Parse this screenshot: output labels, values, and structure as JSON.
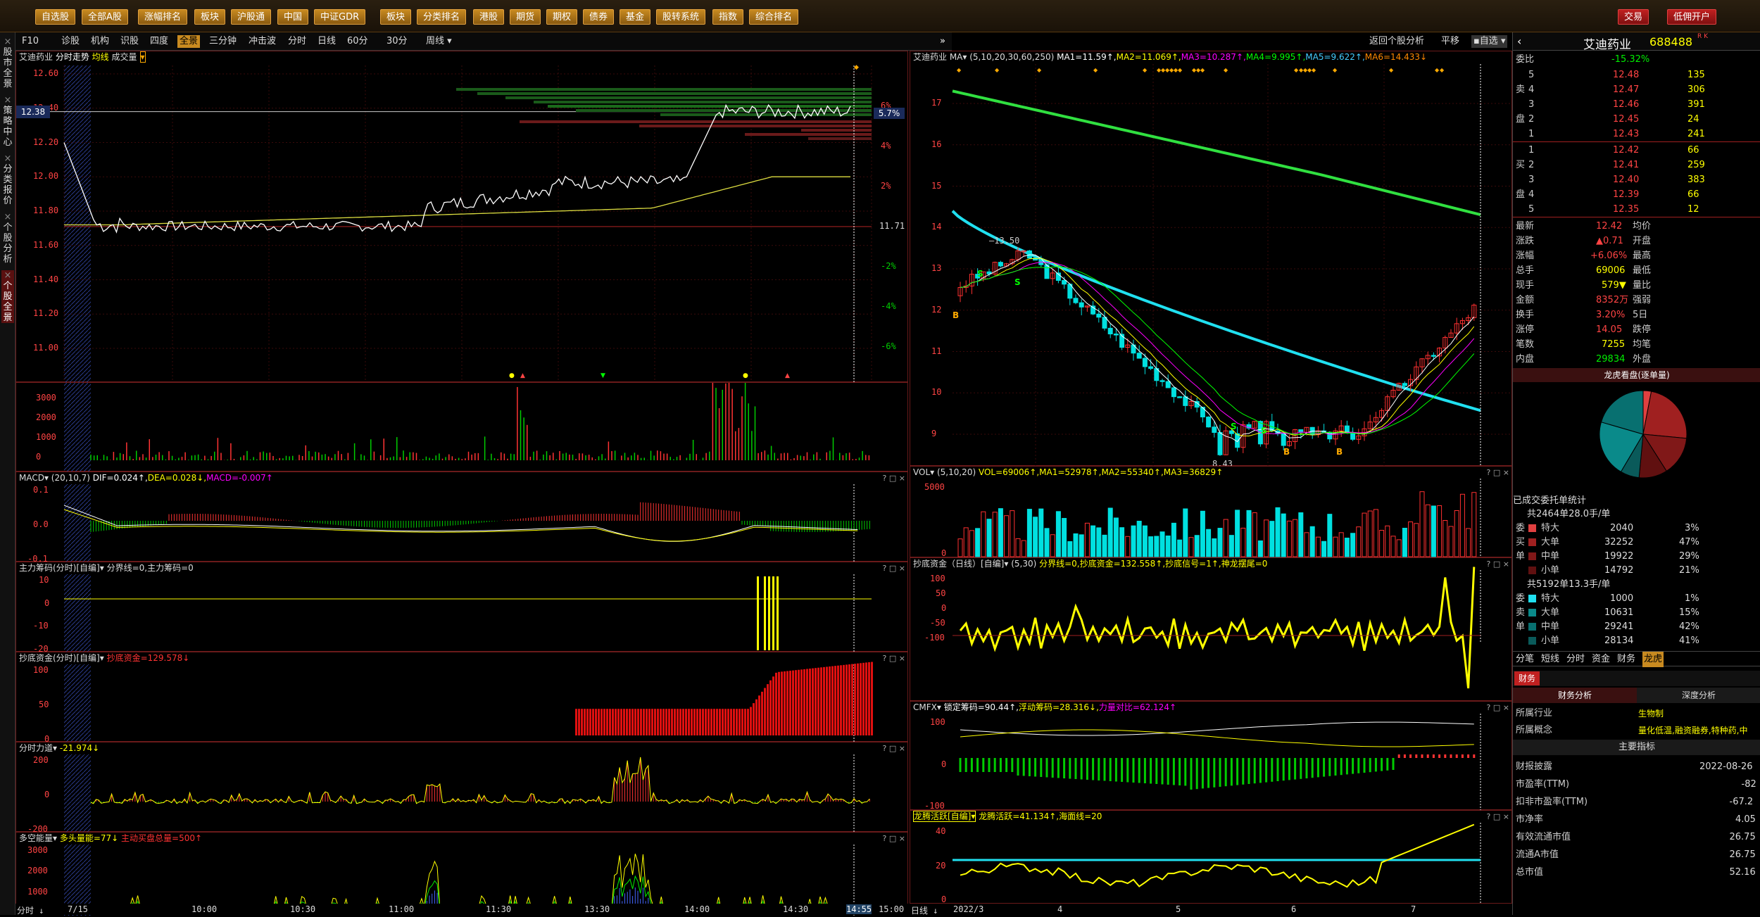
{
  "topbar": {
    "buttons": [
      "自选股",
      "全部A股",
      "涨幅排名",
      "板块",
      "沪股通",
      "中国",
      "中证GDR",
      "板块",
      "分类排名",
      "港股",
      "期货",
      "期权",
      "债券",
      "基金",
      "股转系统",
      "指数",
      "综合排名"
    ],
    "trade": "交易",
    "margin": "低佣开户"
  },
  "lefttabs": [
    "股市全景",
    "策略中心",
    "分类报价",
    "个股分析",
    "个股全景"
  ],
  "toolbar2": {
    "items": [
      "F10",
      "诊股",
      "机构",
      "识股",
      "四度",
      "全景",
      "三分钟",
      "冲击波",
      "分时",
      "日线",
      "60分",
      "30分",
      "周线"
    ],
    "right_items": [
      "返回个股分析",
      "平移",
      "自选"
    ]
  },
  "left": {
    "stock_name": "艾迪药业",
    "title": "分时走势",
    "avg_label": "均线",
    "vol_label": "成交量",
    "price_axis": [
      "12.60",
      "12.40",
      "12.20",
      "12.00",
      "11.80",
      "11.60",
      "11.40",
      "11.20",
      "11.00"
    ],
    "pct_axis": [
      "6%",
      "4%",
      "2%",
      "",
      "-2%",
      "-4%",
      "-6%"
    ],
    "cur_price": "12.38",
    "cur_pct": "5.7%",
    "prev_close": "11.71",
    "vol_axis": [
      "3000",
      "2000",
      "1000",
      "0"
    ],
    "time_axis": [
      "7/15",
      "10:00",
      "10:30",
      "11:00",
      "11:30",
      "13:30",
      "14:00",
      "14:30",
      "14:55",
      "15:00"
    ],
    "footer": "分时",
    "macd": {
      "head": "MACD",
      "params": "(20,10,7)",
      "dif": "DIF=0.024↑",
      "dea": "DEA=0.028↓",
      "macd": "MACD=-0.007↑",
      "axis": [
        "0.1",
        "0.0",
        "-0.1"
      ]
    },
    "zl": {
      "head": "主力筹码(分时)[自编]",
      "text": "分界线=0,主力筹码=0",
      "axis": [
        "10",
        "0",
        "-10",
        "-20"
      ]
    },
    "cd": {
      "head": "抄底资金(分时)[自编]",
      "text": "抄底资金=129.578↓",
      "axis": [
        "100",
        "50",
        "0"
      ]
    },
    "fs": {
      "head": "分时力道",
      "text": "-21.974↓",
      "axis": [
        "200",
        "0",
        "-200"
      ]
    },
    "dk": {
      "head": "多空能量",
      "text1": "多头量能=77↓",
      "text2": "主动买盘总量=500↑",
      "axis": [
        "3000",
        "2000",
        "1000",
        "0"
      ]
    }
  },
  "kline": {
    "head": "艾迪药业",
    "ma_label": "MA",
    "params": "(5,10,20,30,60,250)",
    "ma_values": [
      "MA1=11.59↑",
      "MA2=11.069↑",
      "MA3=10.287↑",
      "MA4=9.995↑",
      "MA5=9.622↑",
      "MA6=14.433↓"
    ],
    "price_axis": [
      "17",
      "16",
      "15",
      "14",
      "13",
      "12",
      "11",
      "10",
      "9"
    ],
    "high_label": "13.50",
    "low_label": "8.43",
    "vol": {
      "head": "VOL",
      "params": "(5,10,20)",
      "text": "VOL=69006↑,MA1=52978↑,MA2=55340↑,MA3=36829↑",
      "axis": [
        "5000",
        "0"
      ]
    },
    "cd": {
      "head": "抄底资金（日线）[自编]",
      "params": "(5,30)",
      "text": "分界线=0,抄底资金=132.558↑,抄底信号=1↑,神龙摆尾=0",
      "axis": [
        "100",
        "50",
        "0",
        "-50",
        "-100"
      ]
    },
    "cmfx": {
      "head": "CMFX",
      "text1": "锁定筹码=90.44↑",
      "text2": "浮动筹码=28.316↓",
      "text3": "力量对比=62.124↑",
      "axis": [
        "100",
        "0",
        "-100"
      ]
    },
    "lt": {
      "head": "龙腾活跃[自编]",
      "text": "龙腾活跃=41.134↑,海面线=20",
      "axis": [
        "40",
        "20",
        "0"
      ]
    },
    "date_axis": [
      "2022/3",
      "4",
      "5",
      "6",
      "7"
    ],
    "footer": "日线"
  },
  "quote": {
    "name": "艾迪药业",
    "code": "688488",
    "weibi_label": "委比",
    "weibi": "-15.32%",
    "asks": [
      {
        "lvl": "5",
        "p": "12.48",
        "v": "135"
      },
      {
        "lvl": "4",
        "p": "12.47",
        "v": "306"
      },
      {
        "lvl": "3",
        "p": "12.46",
        "v": "391"
      },
      {
        "lvl": "2",
        "p": "12.45",
        "v": "24"
      },
      {
        "lvl": "1",
        "p": "12.43",
        "v": "241"
      }
    ],
    "bids": [
      {
        "lvl": "1",
        "p": "12.42",
        "v": "66"
      },
      {
        "lvl": "2",
        "p": "12.41",
        "v": "259"
      },
      {
        "lvl": "3",
        "p": "12.40",
        "v": "383"
      },
      {
        "lvl": "4",
        "p": "12.39",
        "v": "66"
      },
      {
        "lvl": "5",
        "p": "12.35",
        "v": "12"
      }
    ],
    "stats": [
      [
        "最新",
        "12.42",
        "均价",
        ""
      ],
      [
        "涨跌",
        "▲0.71",
        "开盘",
        ""
      ],
      [
        "涨幅",
        "+6.06%",
        "最高",
        ""
      ],
      [
        "总手",
        "69006",
        "最低",
        ""
      ],
      [
        "现手",
        "579▼",
        "量比",
        ""
      ],
      [
        "金额",
        "8352万",
        "强弱",
        ""
      ],
      [
        "换手",
        "3.20%",
        "5日",
        ""
      ],
      [
        "涨停",
        "14.05",
        "跌停",
        ""
      ],
      [
        "笔数",
        "7255",
        "均笔",
        ""
      ],
      [
        "内盘",
        "29834",
        "外盘",
        ""
      ]
    ],
    "pie_title": "龙虎看盘(逐单量)",
    "order_title": "已成交委托单统计",
    "buy_head": "共2464单28.0手/单",
    "buy": [
      [
        "特大",
        "2040",
        "3%"
      ],
      [
        "大单",
        "32252",
        "47%"
      ],
      [
        "中单",
        "19922",
        "29%"
      ],
      [
        "小单",
        "14792",
        "21%"
      ]
    ],
    "sell_head": "共5192单13.3手/单",
    "sell": [
      [
        "特大",
        "1000",
        "1%"
      ],
      [
        "大单",
        "10631",
        "15%"
      ],
      [
        "中单",
        "29241",
        "42%"
      ],
      [
        "小单",
        "28134",
        "41%"
      ]
    ],
    "tabs": [
      "分笔",
      "短线",
      "分时",
      "资金",
      "财务",
      "龙虎"
    ],
    "fin_tab": "财务",
    "fin_sub": [
      "财务分析",
      "深度分析"
    ],
    "industry_label": "所属行业",
    "industry": "生物制",
    "concept_label": "所属概念",
    "concept": "量化低温,融资融券,特种药,中",
    "main_idx": "主要指标",
    "fin": [
      [
        "财报披露",
        "2022-08-26"
      ],
      [
        "市盈率(TTM)",
        "-82"
      ],
      [
        "扣非市盈率(TTM)",
        "-67.2"
      ],
      [
        "市净率",
        "4.05"
      ],
      [
        "有效流通市值",
        "26.75"
      ],
      [
        "流通A市值",
        "26.75"
      ],
      [
        "总市值",
        "52.16"
      ]
    ]
  },
  "colors": {
    "up": "#ff3030",
    "down": "#00e0e0",
    "yellow": "#ffff00",
    "white": "#ffffff",
    "green_ma": "#40e040",
    "cyan_ma": "#20e8f0"
  }
}
